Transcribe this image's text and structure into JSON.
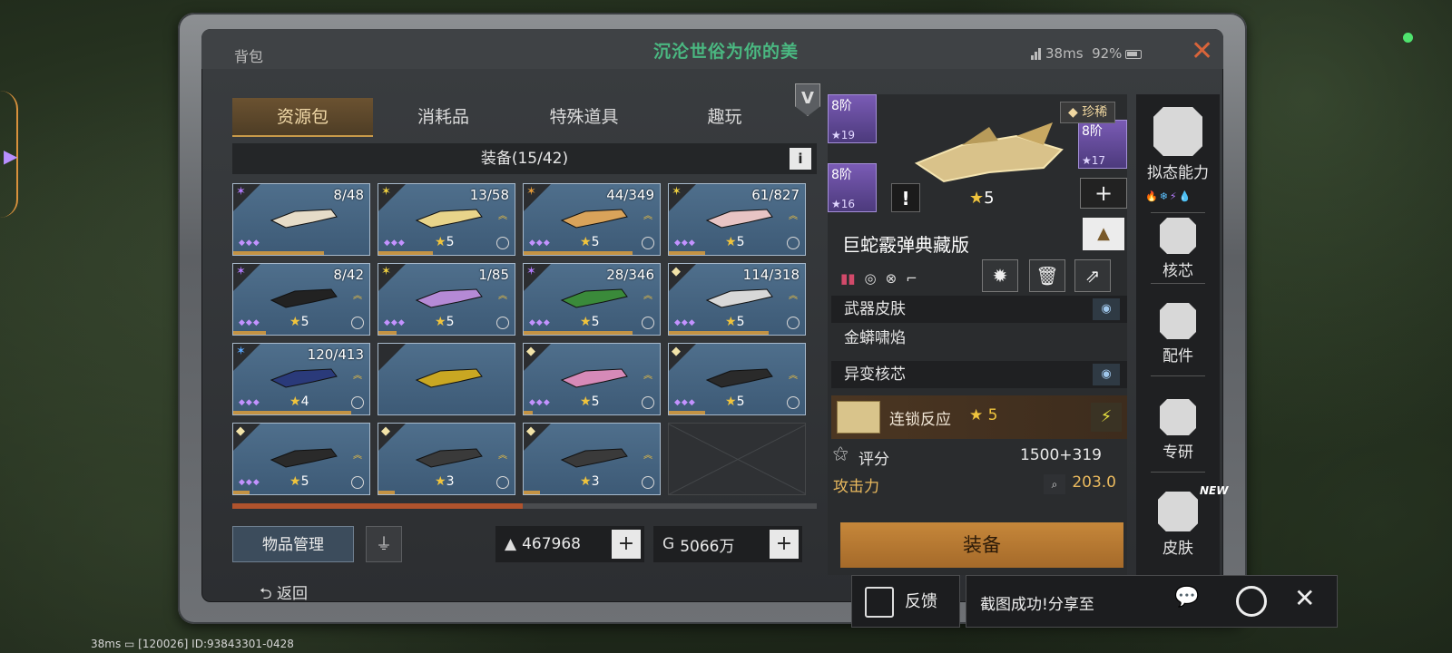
{
  "window": {
    "title": "背包",
    "banner": "沉沦世俗为你的美",
    "latency": "38ms",
    "battery": "92%"
  },
  "tabs": [
    "资源包",
    "消耗品",
    "特殊道具",
    "趣玩"
  ],
  "active_tab": "资源包",
  "equipment_header": "装备(15/42)",
  "info_button": "i",
  "v_badge": "V",
  "items": [
    {
      "count": "8/48",
      "star": "",
      "icon": "purple-claw-icon",
      "rarity_dots": "◆◆◆"
    },
    {
      "count": "13/58",
      "star": "5",
      "icon": "gold-claw-icon",
      "rarity_dots": "◆◆◆"
    },
    {
      "count": "44/349",
      "star": "5",
      "icon": "bronze-claw-icon",
      "rarity_dots": "◆◆◆"
    },
    {
      "count": "61/827",
      "star": "5",
      "icon": "gold-claw-icon",
      "rarity_dots": "◆◆◆"
    },
    {
      "count": "8/42",
      "star": "5",
      "icon": "purple-claw-icon",
      "rarity_dots": "◆◆◆"
    },
    {
      "count": "1/85",
      "star": "5",
      "icon": "gold-claw-icon",
      "rarity_dots": "◆◆◆"
    },
    {
      "count": "28/346",
      "star": "5",
      "icon": "purple-claw-icon",
      "rarity_dots": "◆◆◆"
    },
    {
      "count": "114/318",
      "star": "5",
      "icon": "gem-icon",
      "rarity_dots": "◆◆◆"
    },
    {
      "count": "120/413",
      "star": "4",
      "icon": "blue-claw-icon",
      "rarity_dots": "◆◆◆"
    },
    {
      "count": "",
      "star": "",
      "icon": "",
      "rarity_dots": ""
    },
    {
      "count": "",
      "star": "5",
      "icon": "gem-icon",
      "rarity_dots": "◆◆◆"
    },
    {
      "count": "",
      "star": "5",
      "icon": "gem-icon",
      "rarity_dots": "◆◆◆"
    },
    {
      "count": "",
      "star": "5",
      "icon": "gem-icon",
      "rarity_dots": "◆◆◆"
    },
    {
      "count": "",
      "star": "3",
      "icon": "gem-icon",
      "rarity_dots": ""
    },
    {
      "count": "",
      "star": "3",
      "icon": "gem-icon",
      "rarity_dots": ""
    }
  ],
  "bottom": {
    "manage_label": "物品管理",
    "currency1": "467968",
    "currency2": "5066万",
    "back_label": "返回"
  },
  "detail": {
    "tier1": {
      "label": "8阶",
      "stars": "19"
    },
    "tier2": {
      "label": "8阶",
      "stars": "16"
    },
    "tier3": {
      "label": "8阶",
      "stars": "17"
    },
    "rarity": "珍稀",
    "main_star": "5",
    "weapon_name": "巨蛇霰弹典藏版",
    "skin_label": "武器皮肤",
    "skin_value": "金蟒啸焰",
    "core_label": "异变核芯",
    "chain_label": "连锁反应",
    "chain_star": "5",
    "score_label": "评分",
    "score_value": "1500+319",
    "attack_label": "攻击力",
    "attack_value": "203.0",
    "equip_label": "装备"
  },
  "side_menu": [
    {
      "label": "拟态能力"
    },
    {
      "label": "核芯"
    },
    {
      "label": "配件"
    },
    {
      "label": "专研"
    },
    {
      "label": "皮肤"
    }
  ],
  "new_badge": "NEW",
  "share": {
    "feedback": "反馈",
    "message": "截图成功!分享至"
  },
  "footer": "38ms ▭ [120026] ID:93843301-0428"
}
